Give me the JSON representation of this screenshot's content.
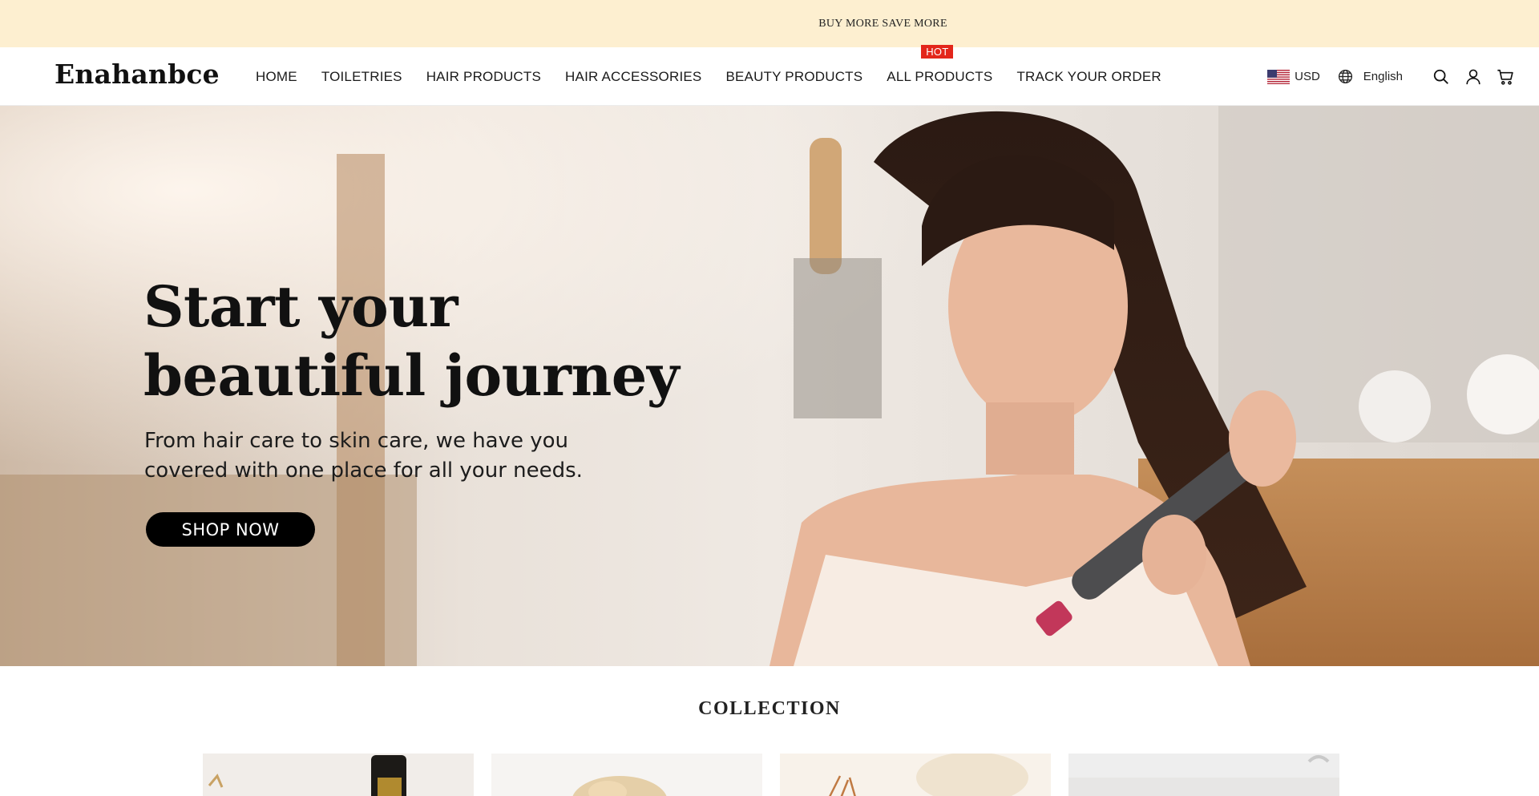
{
  "announcement": {
    "text": "BUY MORE SAVE MORE"
  },
  "header": {
    "logo": "Enahanbce",
    "nav": [
      {
        "label": "HOME"
      },
      {
        "label": "TOILETRIES"
      },
      {
        "label": "HAIR PRODUCTS"
      },
      {
        "label": "HAIR ACCESSORIES"
      },
      {
        "label": "BEAUTY PRODUCTS"
      },
      {
        "label": "ALL PRODUCTS",
        "badge": "HOT"
      },
      {
        "label": "TRACK YOUR ORDER"
      }
    ],
    "currency": "USD",
    "language": "English",
    "icons": [
      "us-flag-icon",
      "globe-icon",
      "search-icon",
      "account-icon",
      "cart-icon"
    ]
  },
  "hero": {
    "title_line1": "Start your",
    "title_line2": "beautiful journey",
    "subtitle_line1": "From hair care to skin care, we have you",
    "subtitle_line2": "covered with one place for all your needs.",
    "cta": "SHOP NOW"
  },
  "collection": {
    "title": "COLLECTION",
    "cards": [
      {
        "name": "collection-card-1"
      },
      {
        "name": "collection-card-2"
      },
      {
        "name": "collection-card-3"
      },
      {
        "name": "collection-card-4"
      }
    ]
  },
  "colors": {
    "announcement_bg": "#fdefd0",
    "hot_badge": "#e3261b",
    "cta_bg": "#000000",
    "cta_text": "#ffffff"
  }
}
